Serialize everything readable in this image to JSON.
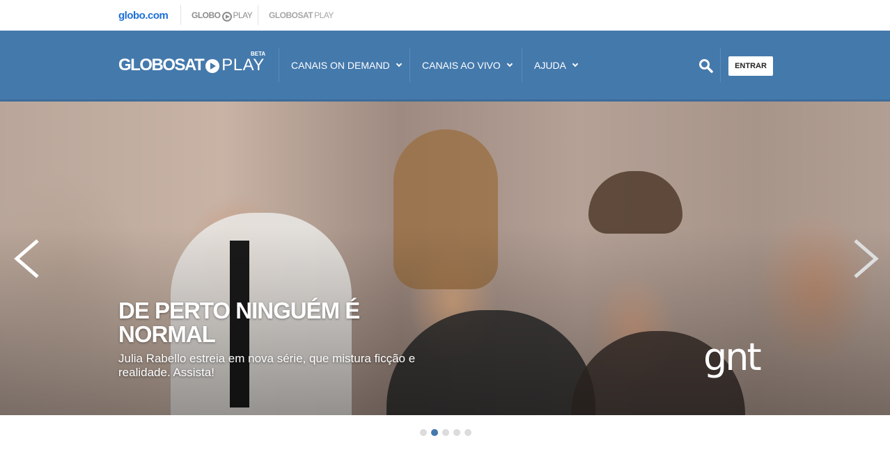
{
  "network_bar": {
    "globo_com": "globo.com",
    "globoplay": {
      "left": "GLOBO",
      "right": "PLAY"
    },
    "globosat_play": {
      "left": "GLOBOSAT",
      "right": "PLAY"
    }
  },
  "header": {
    "logo": {
      "main": "GLOBOSAT",
      "play": "PLAY",
      "beta": "BETA"
    },
    "nav": [
      {
        "label": "CANAIS ON DEMAND"
      },
      {
        "label": "CANAIS AO VIVO"
      },
      {
        "label": "AJUDA"
      }
    ],
    "login_label": "ENTRAR"
  },
  "hero": {
    "title": "DE PERTO NINGUÉM É NORMAL",
    "description": "Julia Rabello estreia em nova série, que mistura ficção e realidade. Assista!",
    "channel": "gnt"
  },
  "carousel": {
    "slide_count": 5,
    "active_index": 1
  },
  "colors": {
    "header_bg": "#4479ac",
    "globo_blue": "#1d6fd6",
    "dot_inactive": "#dcdcdc",
    "dot_active": "#4479ac"
  },
  "icons": [
    "search-icon",
    "chevron-down-icon",
    "arrow-left-icon",
    "arrow-right-icon",
    "play-circle-icon"
  ]
}
